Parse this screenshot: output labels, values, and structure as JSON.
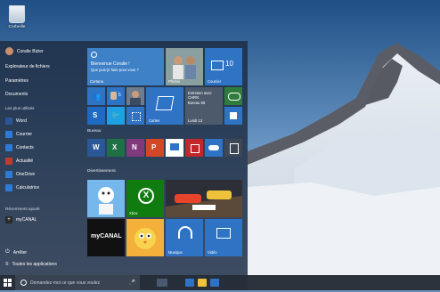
{
  "desktop": {
    "recycle_bin_label": "Corbeille"
  },
  "user": {
    "name": "Coralie Bizier"
  },
  "left_menu": {
    "top_items": [
      "Explorateur de fichiers",
      "Paramètres",
      "Documents"
    ],
    "most_used_title": "Les plus utilisés",
    "most_used": [
      {
        "label": "Word",
        "color": "#2b5797"
      },
      {
        "label": "Courrier",
        "color": "#2d7bd6"
      },
      {
        "label": "Contacts",
        "color": "#2d7bd6"
      },
      {
        "label": "Actualité",
        "color": "#c13b2d"
      },
      {
        "label": "OneDrive",
        "color": "#2d7bd6"
      },
      {
        "label": "Calculatrice",
        "color": "#2d7bd6"
      }
    ],
    "recent_title": "Récemment ajouté",
    "recent_item": "myCANAL",
    "power_label": "Arrêter",
    "all_apps_label": "Toutes les applications"
  },
  "tiles": {
    "cortana_greeting": "Bienvenue Coralie !",
    "cortana_sub": "Que puis-je faire pour vous ?",
    "cortana_label": "Cortana",
    "photos_label": "Photos",
    "mail_count": "10",
    "mail_label": "Courrier",
    "contacts_count": "5",
    "cartes_label": "Cartes",
    "calendar_text": "Entretien avec CHRN",
    "calendar_sub": "Bureau 56",
    "calendar_day": "Lundi 13",
    "bureau_title": "Bureau",
    "divert_title": "Divertissement",
    "xbox_label": "Xbox",
    "musique_label": "Musique",
    "video_label": "Vidéo",
    "mycanal_text": "myCANAL"
  },
  "taskbar": {
    "search_placeholder": "Demandez-moi ce que vous voulez"
  },
  "colors": {
    "accent": "#3a7dc2"
  }
}
